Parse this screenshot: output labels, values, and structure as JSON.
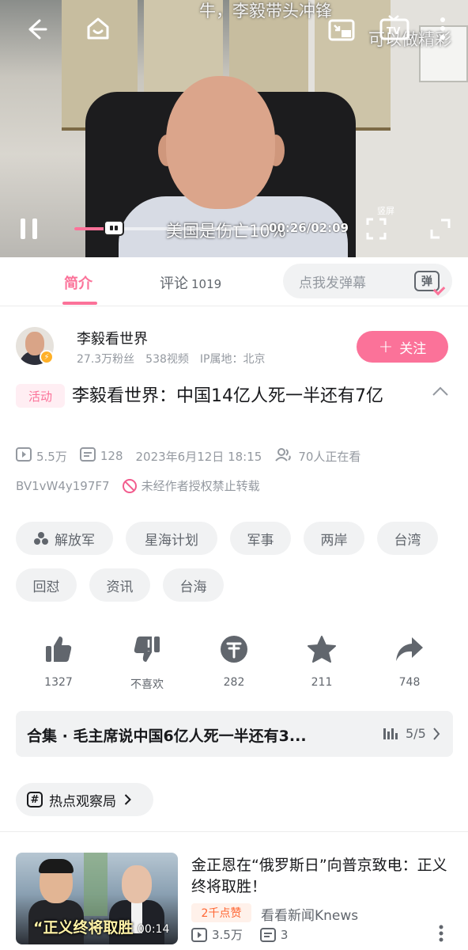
{
  "player": {
    "subtitle_top_line1": "牛，李毅带头冲锋",
    "subtitle_top_line2": "可以做精彩",
    "subtitle_bottom": "美国是伤亡10%",
    "time": "00:26/02:09",
    "progress_fraction": 0.2,
    "vertical_label": "竖屏"
  },
  "tabs": {
    "intro": "简介",
    "comments": "评论",
    "comments_count": "1019",
    "danmaku_placeholder": "点我发弹幕",
    "danmaku_button": "弹"
  },
  "uploader": {
    "name": "李毅看世界",
    "fans": "27.3万粉丝",
    "videos": "538视频",
    "ip": "IP属地：北京",
    "follow_label": "关注"
  },
  "video": {
    "badge": "活动",
    "title": "李毅看世界：中国14亿人死一半还有7亿",
    "views": "5.5万",
    "danmaku_count": "128",
    "date": "2023年6月12日 18:15",
    "watching": "70人正在看",
    "bvid": "BV1vW4y197F7",
    "no_repost": "未经作者授权禁止转载"
  },
  "tags": [
    "解放军",
    "星海计划",
    "军事",
    "两岸",
    "台湾",
    "回怼",
    "资讯",
    "台海"
  ],
  "actions": {
    "like": "1327",
    "dislike": "不喜欢",
    "coin": "282",
    "favorite": "211",
    "share": "748"
  },
  "collection": {
    "title": "合集 · 毛主席说中国6亿人死一半还有3...",
    "progress": "5/5"
  },
  "hot_topic": "热点观察局",
  "recommended": {
    "title": "金正恩在“俄罗斯日”向普京致电：正义终将取胜！",
    "thumb_caption": "“正义终将取胜",
    "duration": "00:14",
    "badge": "2千点赞",
    "author": "看看新闻Knews",
    "views": "3.5万",
    "danmaku": "3"
  },
  "colors": {
    "brand_pink": "#fb7299",
    "text_primary": "#18191c",
    "text_secondary": "#61666d",
    "text_muted": "#9499a0",
    "chip_bg": "#f1f2f3"
  }
}
